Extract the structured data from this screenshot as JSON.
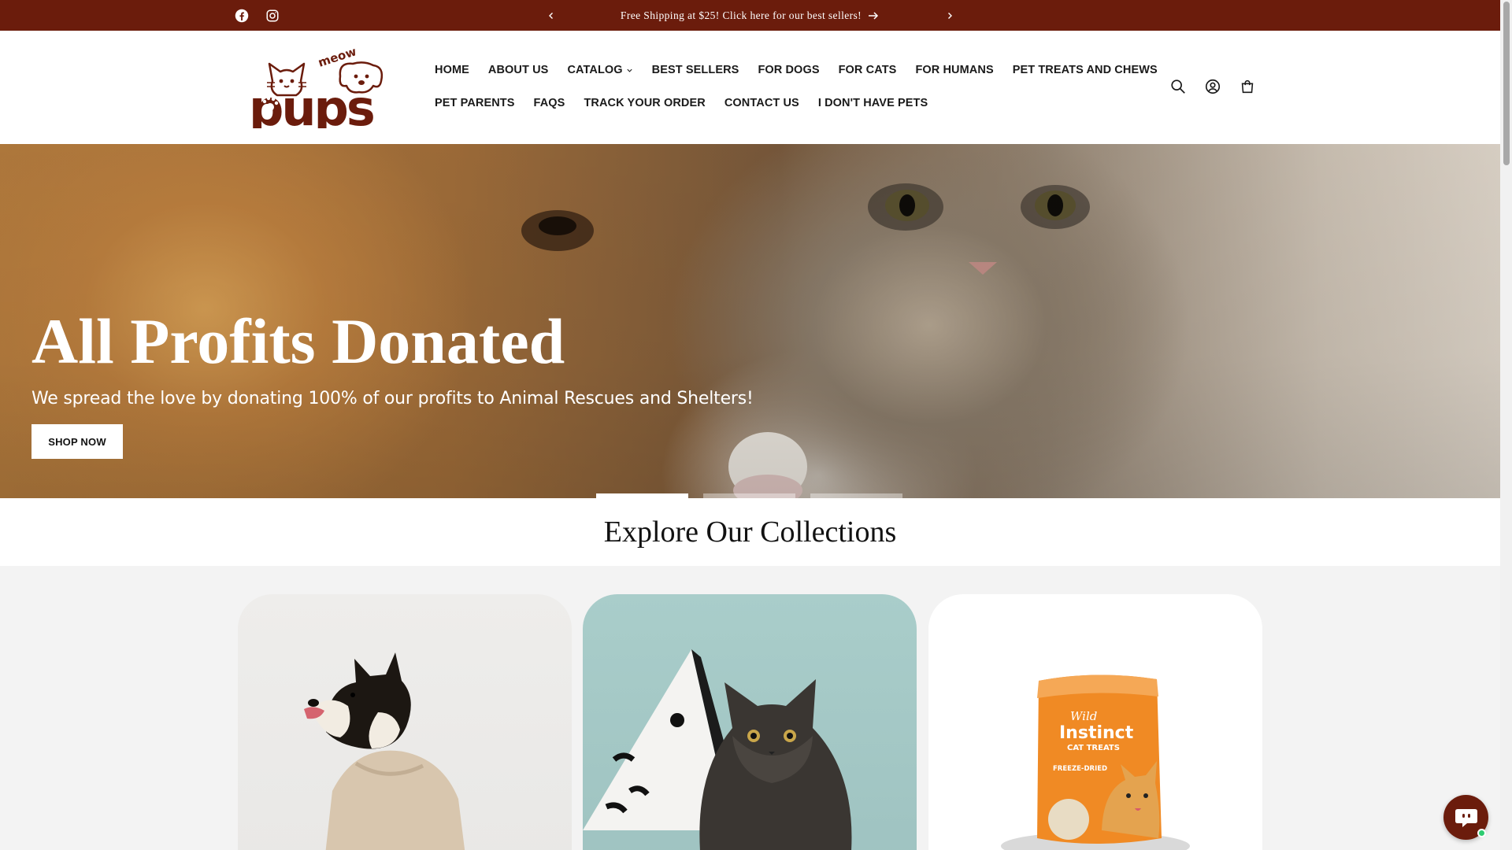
{
  "announcement": {
    "message": "Free Shipping at $25! Click here for our best sellers!",
    "social": [
      "facebook-icon",
      "instagram-icon"
    ]
  },
  "brand": {
    "logo_small_text": "meow",
    "logo_text": "pups",
    "color": "#6b1c0c"
  },
  "nav": {
    "row1": [
      "HOME",
      "ABOUT US",
      "CATALOG",
      "BEST SELLERS",
      "FOR DOGS",
      "FOR CATS",
      "FOR HUMANS",
      "PET TREATS AND CHEWS"
    ],
    "row2": [
      "PET PARENTS",
      "FAQS",
      "TRACK YOUR ORDER",
      "CONTACT US",
      "I DON'T HAVE PETS"
    ]
  },
  "header_icons": [
    "search-icon",
    "account-icon",
    "cart-icon"
  ],
  "hero": {
    "title": "All Profits Donated",
    "subtitle": "We spread the love by donating 100% of our profits to Animal Rescues and Shelters!",
    "button": "SHOP NOW",
    "slides": 3,
    "active_slide": 1
  },
  "collections": {
    "heading": "Explore Our Collections",
    "product_label": {
      "brand": "Wild",
      "name": "Instinct",
      "line": "CAT TREATS",
      "variant": "FREEZE-DRIED"
    }
  }
}
